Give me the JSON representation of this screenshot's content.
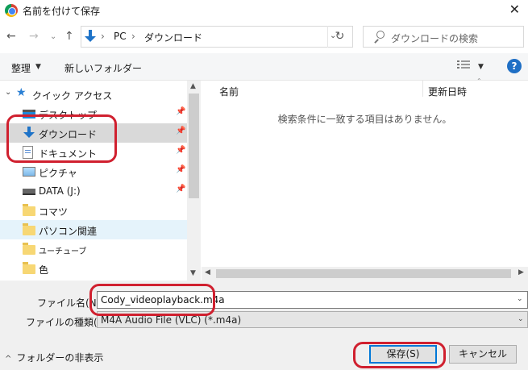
{
  "window": {
    "title": "名前を付けて保存",
    "close_glyph": "✕"
  },
  "navbar": {
    "back_glyph": "←",
    "forward_glyph": "→",
    "recent_glyph": "⌄",
    "up_glyph": "↑",
    "breadcrumb": [
      "PC",
      "ダウンロード"
    ],
    "separator_glyph": "›",
    "dropdown_glyph": "⌄",
    "refresh_glyph": "↻",
    "search_placeholder": "ダウンロードの検索"
  },
  "toolbar": {
    "organize_label": "整理",
    "organize_arrow": "▼",
    "new_folder_label": "新しいフォルダー",
    "view_arrow": "▼",
    "help_glyph": "?"
  },
  "navpane": {
    "quick_access": {
      "chevron": "⌄",
      "star": "★",
      "label": "クイック アクセス"
    },
    "pin_glyph": "📌",
    "items": [
      {
        "label": "デスクトップ",
        "icon": "desktop-icon",
        "pinned": true
      },
      {
        "label": "ダウンロード",
        "icon": "download-icon",
        "pinned": true
      },
      {
        "label": "ドキュメント",
        "icon": "document-icon",
        "pinned": true
      },
      {
        "label": "ピクチャ",
        "icon": "pictures-icon",
        "pinned": true
      },
      {
        "label": "DATA (J:)",
        "icon": "drive-icon",
        "pinned": true
      },
      {
        "label": "コマツ",
        "icon": "folder-icon",
        "pinned": false
      },
      {
        "label": "パソコン関連",
        "icon": "folder-icon",
        "pinned": false
      },
      {
        "label": "ユーチューブ",
        "icon": "folder-icon",
        "pinned": false
      },
      {
        "label": "色",
        "icon": "folder-icon",
        "pinned": false
      }
    ]
  },
  "scroll": {
    "up": "▲",
    "down": "▼",
    "left": "◀",
    "right": "▶"
  },
  "filepane": {
    "columns": [
      "名前",
      "更新日時"
    ],
    "sort_glyph": "⌃",
    "empty_message": "検索条件に一致する項目はありません。"
  },
  "bottom": {
    "filename_label": "ファイル名(N):",
    "filename_value": "Cody_videoplayback.m4a",
    "dropdown_glyph": "⌄",
    "filetype_label": "ファイルの種類(T):",
    "filetype_value": "M4A Audio File (VLC) (*.m4a)",
    "hide_folders_chevron": "^",
    "hide_folders_label": "フォルダーの非表示",
    "save_label": "保存(S)",
    "cancel_label": "キャンセル"
  },
  "colors": {
    "accent": "#0078d7",
    "annotation": "#d0202f",
    "selection": "#d9d9d9"
  }
}
